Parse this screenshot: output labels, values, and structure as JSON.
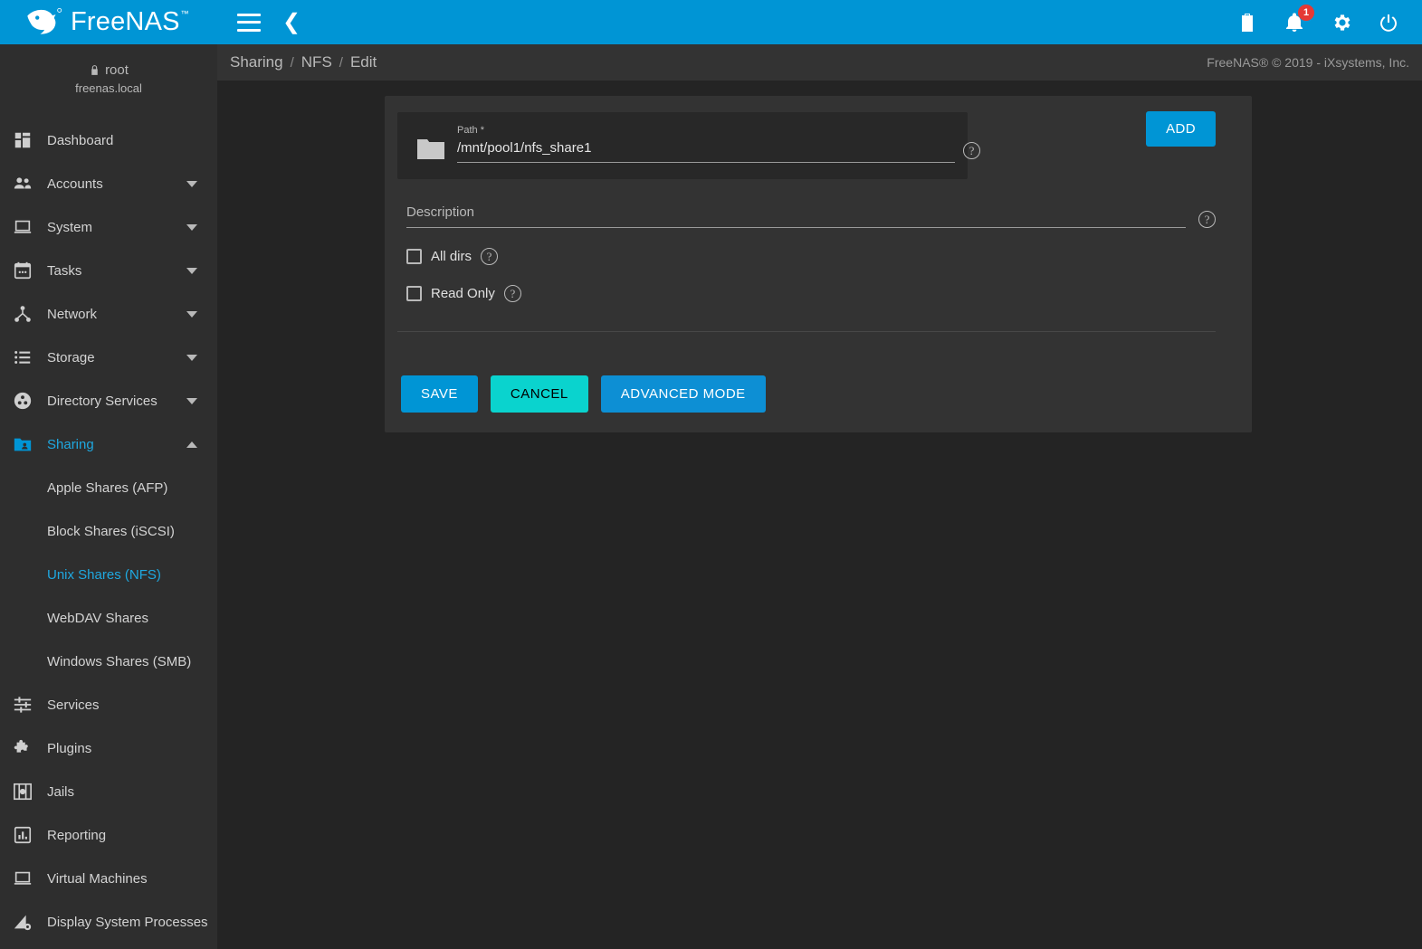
{
  "app": {
    "brand": "FreeNAS",
    "brand_tm": "™",
    "logo_icon": "freenas-fish-logo"
  },
  "topbar": {
    "menu_icon": "hamburger-menu-icon",
    "back_icon": "chevron-left-icon",
    "icons": [
      {
        "name": "clipboard-tasks-icon",
        "label": "Tasks"
      },
      {
        "name": "bell-notifications-icon",
        "label": "Alerts",
        "badge": "1"
      },
      {
        "name": "gear-settings-icon",
        "label": "Settings"
      },
      {
        "name": "power-icon",
        "label": "Power"
      }
    ]
  },
  "sidebar": {
    "avatar_icon": "user-avatar-icon",
    "lock_icon": "lock-icon",
    "username": "root",
    "hostname": "freenas.local",
    "items": [
      {
        "label": "Dashboard",
        "icon": "dashboard-icon",
        "expandable": false,
        "active": false
      },
      {
        "label": "Accounts",
        "icon": "accounts-people-icon",
        "expandable": true,
        "active": false
      },
      {
        "label": "System",
        "icon": "system-laptop-icon",
        "expandable": true,
        "active": false
      },
      {
        "label": "Tasks",
        "icon": "tasks-calendar-icon",
        "expandable": true,
        "active": false
      },
      {
        "label": "Network",
        "icon": "network-nodes-icon",
        "expandable": true,
        "active": false
      },
      {
        "label": "Storage",
        "icon": "storage-list-icon",
        "expandable": true,
        "active": false
      },
      {
        "label": "Directory Services",
        "icon": "directory-services-icon",
        "expandable": true,
        "active": false
      },
      {
        "label": "Sharing",
        "icon": "sharing-folder-icon",
        "expandable": true,
        "active": true,
        "expanded": true
      }
    ],
    "sharing_children": [
      {
        "label": "Apple Shares (AFP)",
        "active": false
      },
      {
        "label": "Block Shares (iSCSI)",
        "active": false
      },
      {
        "label": "Unix Shares (NFS)",
        "active": true
      },
      {
        "label": "WebDAV Shares",
        "active": false
      },
      {
        "label": "Windows Shares (SMB)",
        "active": false
      }
    ],
    "items_tail": [
      {
        "label": "Services",
        "icon": "services-sliders-icon"
      },
      {
        "label": "Plugins",
        "icon": "plugins-puzzle-icon"
      },
      {
        "label": "Jails",
        "icon": "jails-icon"
      },
      {
        "label": "Reporting",
        "icon": "reporting-chart-icon"
      },
      {
        "label": "Virtual Machines",
        "icon": "virtual-machines-icon"
      },
      {
        "label": "Display System Processes",
        "icon": "display-system-processes-icon"
      }
    ]
  },
  "breadcrumb": {
    "items": [
      "Sharing",
      "NFS",
      "Edit"
    ],
    "separator": "/",
    "copyright": "FreeNAS® © 2019 - iXsystems, Inc."
  },
  "form": {
    "path": {
      "label": "Path",
      "required_marker": "*",
      "value": "/mnt/pool1/nfs_share1",
      "placeholder": "",
      "folder_icon": "folder-icon",
      "help_icon": "help-circle-icon"
    },
    "add_button": "ADD",
    "description": {
      "label": "Description",
      "value": "",
      "placeholder": "Description",
      "help_icon": "help-circle-icon"
    },
    "checkboxes": [
      {
        "label": "All dirs",
        "checked": false,
        "help_icon": "help-circle-icon"
      },
      {
        "label": "Read Only",
        "checked": false,
        "help_icon": "help-circle-icon"
      }
    ],
    "buttons": {
      "save": "SAVE",
      "cancel": "CANCEL",
      "advanced": "ADVANCED MODE"
    }
  },
  "colors": {
    "accent_blue": "#0095d5",
    "cancel_teal": "#0ad3ce",
    "badge_red": "#e53935",
    "sidebar_bg": "#2e2e2e",
    "card_bg": "#333333",
    "page_bg": "#242424",
    "active_link": "#1fa8e0"
  }
}
